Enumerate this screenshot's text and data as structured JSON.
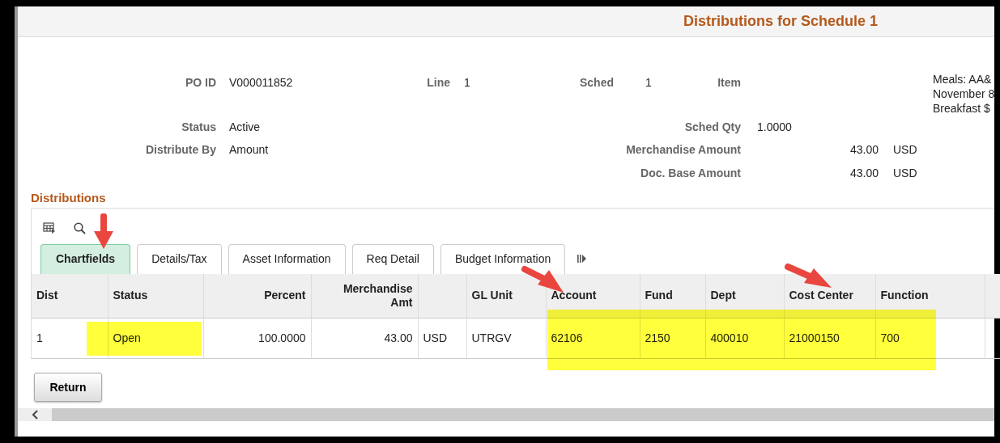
{
  "page_title": "Distributions for Schedule 1",
  "header": {
    "po_id": {
      "label": "PO ID",
      "value": "V000011852"
    },
    "line": {
      "label": "Line",
      "value": "1"
    },
    "sched": {
      "label": "Sched",
      "value": "1"
    },
    "item": {
      "label": "Item",
      "description": [
        "Meals: AA&",
        "November 8",
        "Breakfast $"
      ]
    },
    "status": {
      "label": "Status",
      "value": "Active"
    },
    "sched_qty": {
      "label": "Sched Qty",
      "value": "1.0000"
    },
    "distribute_by": {
      "label": "Distribute By",
      "value": "Amount"
    },
    "merchandise_amount": {
      "label": "Merchandise Amount",
      "value": "43.00",
      "currency": "USD"
    },
    "doc_base_amount": {
      "label": "Doc. Base Amount",
      "value": "43.00",
      "currency": "USD"
    }
  },
  "section_title": "Distributions",
  "tabs": [
    {
      "label": "Chartfields",
      "selected": true
    },
    {
      "label": "Details/Tax",
      "selected": false
    },
    {
      "label": "Asset Information",
      "selected": false
    },
    {
      "label": "Req Detail",
      "selected": false
    },
    {
      "label": "Budget Information",
      "selected": false
    }
  ],
  "table": {
    "columns": [
      {
        "label": "Dist",
        "kind": "text"
      },
      {
        "label": "Status",
        "kind": "text"
      },
      {
        "label": "Percent",
        "kind": "number"
      },
      {
        "label": "Merchandise Amt",
        "kind": "number"
      },
      {
        "kind": "text"
      },
      {
        "label": "GL Unit",
        "kind": "text"
      },
      {
        "label": "Account",
        "kind": "text"
      },
      {
        "label": "Fund",
        "kind": "text"
      },
      {
        "label": "Dept",
        "kind": "text"
      },
      {
        "label": "Cost Center",
        "kind": "text"
      },
      {
        "label": "Function",
        "kind": "text"
      },
      {
        "kind": "text"
      }
    ],
    "rows": [
      {
        "cells": [
          "1",
          "Open",
          "100.0000",
          "43.00",
          "USD",
          "UTRGV",
          "62106",
          "2150",
          "400010",
          "21000150",
          "700"
        ]
      }
    ]
  },
  "buttons": [
    "Return"
  ]
}
